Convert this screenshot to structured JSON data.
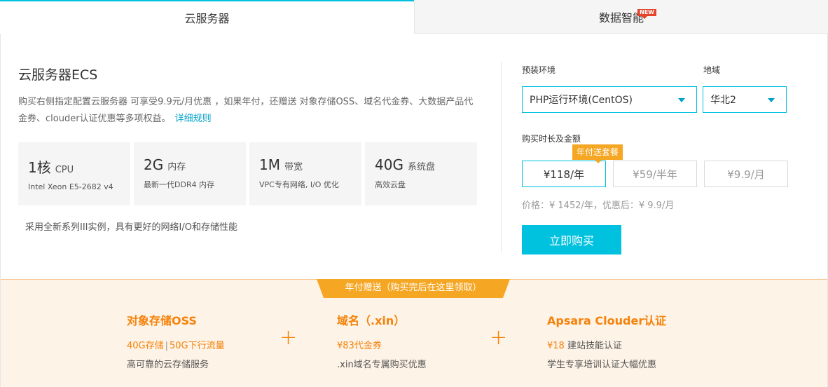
{
  "tabs": {
    "active": "云服务器",
    "inactive": "数据智能",
    "new_badge": "NEW"
  },
  "product": {
    "title": "云服务器ECS",
    "description": "购买右侧指定配置云服务器 可享受9.9元/月优惠 ，如果年付，还赠送 对象存储OSS、域名代金券、大数据产品代金券、clouder认证优惠等多项权益。",
    "detail_link": "详细规则",
    "specs": [
      {
        "main": "1核",
        "unit": "CPU",
        "sub": "Intel Xeon E5-2682 v4"
      },
      {
        "main": "2G",
        "unit": "内存",
        "sub": "最新一代DDR4 内存"
      },
      {
        "main": "1M",
        "unit": "带宽",
        "sub": "VPC专有网络, I/O 优化"
      },
      {
        "main": "40G",
        "unit": "系统盘",
        "sub": "高效云盘"
      }
    ],
    "note": "采用全新系列III实例，具有更好的网络I/O和存储性能"
  },
  "purchase": {
    "env_label": "预装环境",
    "env_value": "PHP运行环境(CentOS)",
    "region_label": "地域",
    "region_value": "华北2",
    "duration_label": "购买时长及金额",
    "promo_tag": "年付送套餐",
    "durations": [
      "¥118/年",
      "¥59/半年",
      "¥9.9/月"
    ],
    "selected_duration": 0,
    "price_text": "价格：¥ 1452/年，优惠后：¥ 9.9/月",
    "buy_label": "立即购买"
  },
  "gifts": {
    "ribbon": "年付赠送（购买完后在这里领取）",
    "items": [
      {
        "title": "对象存储OSS",
        "line1_a": "40G存储",
        "line1_sep": "|",
        "line1_b": "50G下行流量",
        "line2": "高可靠的云存储服务"
      },
      {
        "title": "域名（.xin）",
        "line1_a": "¥83代金券",
        "line2": ".xin域名专属购买优惠"
      },
      {
        "title": "Apsara Clouder认证",
        "line1_a": "¥18",
        "line1_b": "建站技能认证",
        "line2": "学生专享培训认证大幅优惠"
      }
    ],
    "plus": "+"
  },
  "colors": {
    "accent": "#00c1de",
    "link": "#00a2ca",
    "orange": "#f5820b",
    "promo": "#f5a623",
    "badge": "#e5442b"
  }
}
